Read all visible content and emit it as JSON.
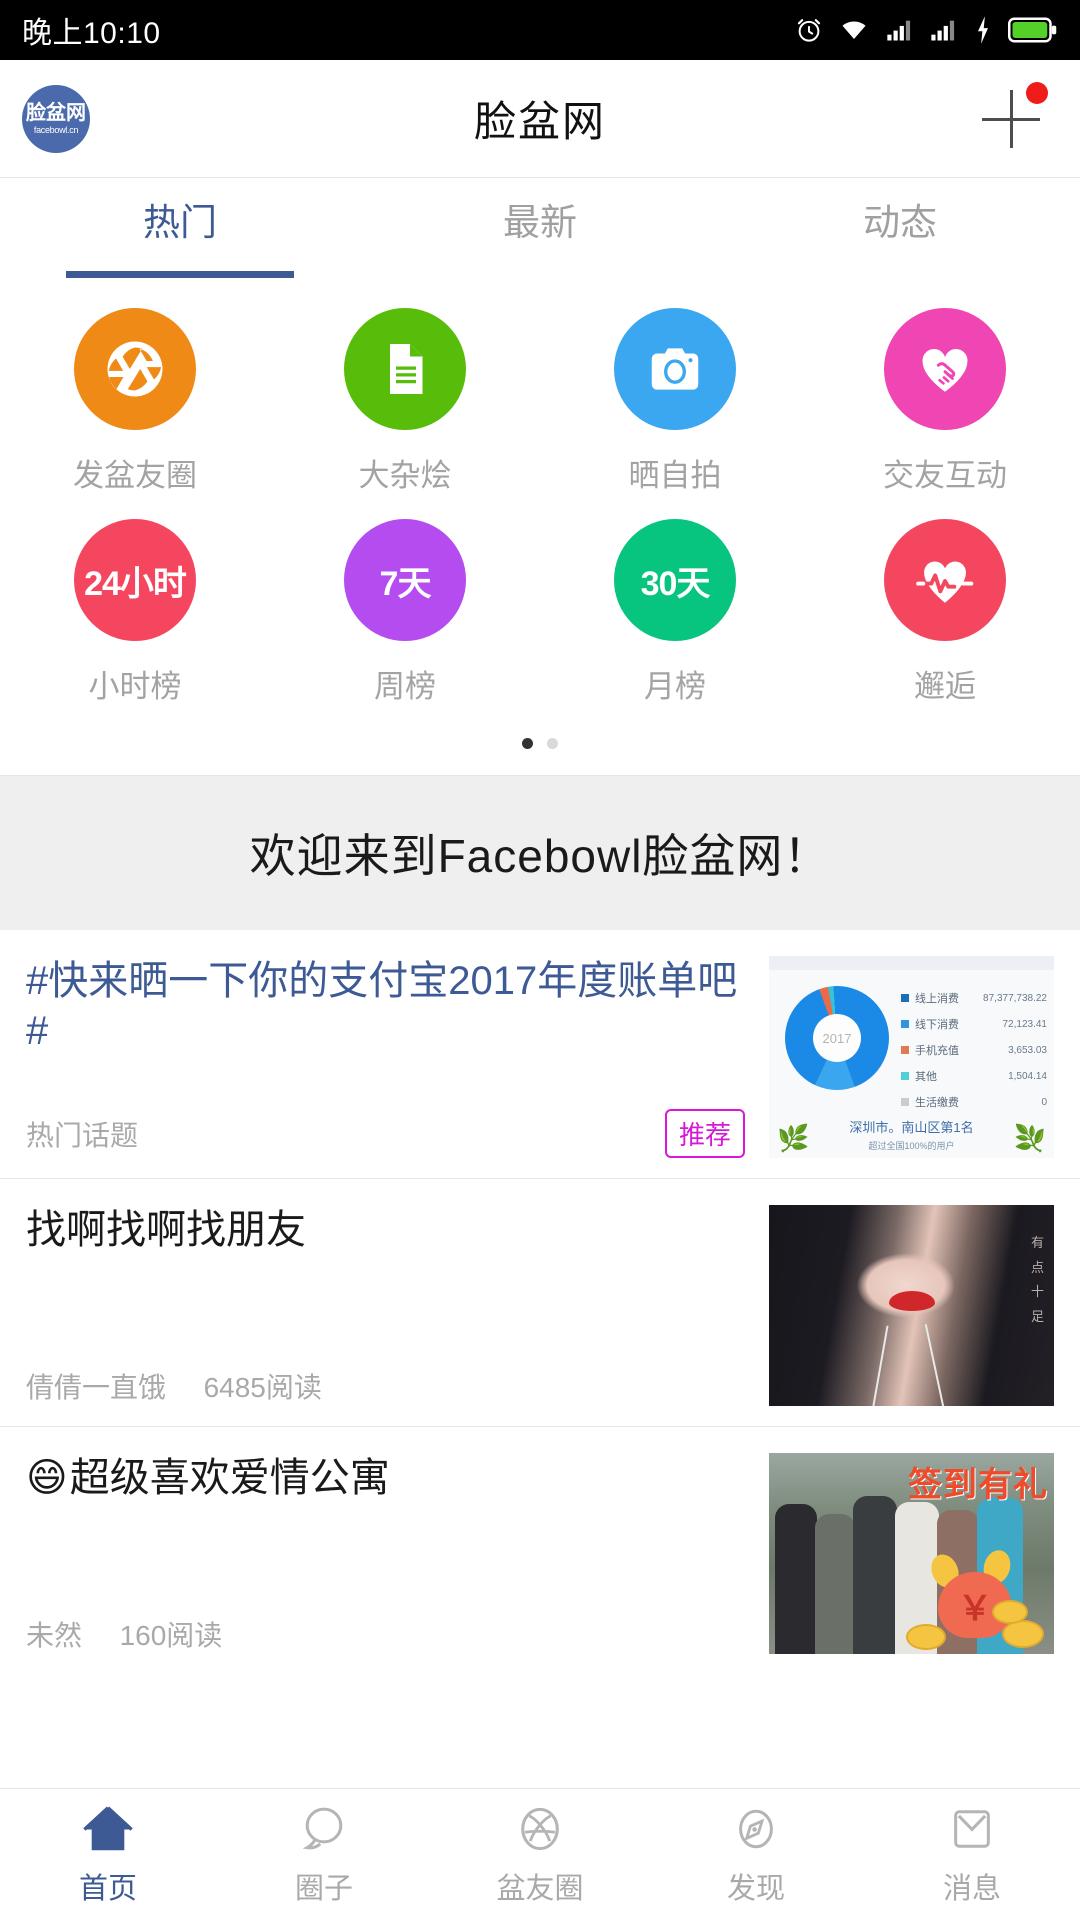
{
  "statusbar": {
    "time": "晚上10:10",
    "icons": [
      "alarm-icon",
      "wifi-icon",
      "signal-1-icon",
      "signal-2-icon",
      "charging-icon",
      "battery-icon"
    ]
  },
  "header": {
    "logo_line1": "脸盆网",
    "logo_line2": "facebowl.cn",
    "title": "脸盆网",
    "add_button": "+",
    "badge": true
  },
  "tabs": [
    {
      "label": "热门",
      "active": true
    },
    {
      "label": "最新",
      "active": false
    },
    {
      "label": "动态",
      "active": false
    }
  ],
  "grid": {
    "row1": [
      {
        "label": "发盆友圈",
        "icon": "aperture-icon",
        "color": "#ef8a16",
        "text": ""
      },
      {
        "label": "大杂烩",
        "icon": "document-icon",
        "color": "#57bd0a",
        "text": ""
      },
      {
        "label": "晒自拍",
        "icon": "camera-icon",
        "color": "#3ba7f0",
        "text": ""
      },
      {
        "label": "交友互动",
        "icon": "handshake-heart-icon",
        "color": "#ef46b4",
        "text": ""
      }
    ],
    "row2": [
      {
        "label": "小时榜",
        "icon": "text-badge",
        "color": "#f4475f",
        "text": "24小时"
      },
      {
        "label": "周榜",
        "icon": "text-badge",
        "color": "#b44cf0",
        "text": "7天"
      },
      {
        "label": "月榜",
        "icon": "text-badge",
        "color": "#07c47f",
        "text": "30天"
      },
      {
        "label": "邂逅",
        "icon": "heart-pulse-icon",
        "color": "#f4475f",
        "text": ""
      }
    ],
    "pager": {
      "count": 2,
      "active": 0
    }
  },
  "welcome": {
    "text": "欢迎来到Facebowl脸盆网！"
  },
  "feed": [
    {
      "title": "#快来晒一下你的支付宝2017年度账单吧#",
      "title_is_link": true,
      "emoji": "",
      "author": "热门话题",
      "reads": "",
      "badge": "推荐",
      "thumb": "alipay-bill-chart"
    },
    {
      "title": "找啊找啊找朋友",
      "title_is_link": false,
      "emoji": "",
      "author": "倩倩一直饿",
      "reads": "6485阅读",
      "badge": "",
      "thumb": "portrait-photo"
    },
    {
      "title": "超级喜欢爱情公寓",
      "title_is_link": false,
      "emoji": "😄",
      "author": "未然",
      "reads": "160阅读",
      "badge": "",
      "thumb": "group-photo-signin"
    }
  ],
  "thumb_chart": {
    "type": "pie",
    "title": "2017",
    "center_label": "2017",
    "categories": [
      "线上消费",
      "线下消费",
      "手机充值",
      "其他",
      "生活缴费"
    ],
    "values": [
      87377738.22,
      72123.41,
      3653.03,
      1504.14,
      0
    ],
    "value_labels": [
      "87,377,738.22",
      "72,123.41",
      "3,653.03",
      "1,504.14",
      "0"
    ],
    "colors": [
      "#1b6fb5",
      "#2f93dd",
      "#e07a52",
      "#4fd0d8",
      "#c8cdd2"
    ],
    "legend_position": "right",
    "footer": "深圳市。南山区第1名",
    "footer_sub": "超过全国100%的用户"
  },
  "thumb_overlay": {
    "signin_text": "签到有礼",
    "currency": "￥"
  },
  "bottomnav": [
    {
      "label": "首页",
      "icon": "home-icon",
      "active": true
    },
    {
      "label": "圈子",
      "icon": "chat-bubble-icon",
      "active": false
    },
    {
      "label": "盆友圈",
      "icon": "aperture-icon",
      "active": false
    },
    {
      "label": "发现",
      "icon": "compass-icon",
      "active": false
    },
    {
      "label": "消息",
      "icon": "envelope-icon",
      "active": false
    }
  ],
  "colors": {
    "accent": "#3d5a94",
    "badge": "#d619d6",
    "alert": "#f01b1b"
  }
}
